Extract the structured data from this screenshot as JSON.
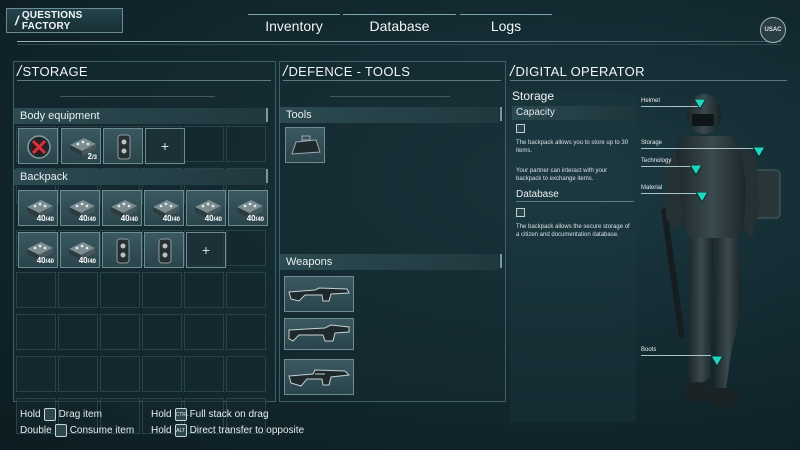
{
  "topbar": {
    "factory_label": "QUESTIONS FACTORY",
    "tabs": [
      "Inventory",
      "Database",
      "Logs"
    ],
    "logo_text": "USAC"
  },
  "storage": {
    "title": "STORAGE",
    "body_equipment_label": "Body equipment",
    "backpack_label": "Backpack",
    "body_items": [
      {
        "icon": "medkit-icon",
        "qty": ""
      },
      {
        "icon": "ammo-box-icon",
        "qty": "2",
        "max": "3"
      },
      {
        "icon": "device-icon",
        "qty": ""
      }
    ],
    "backpack_items": [
      {
        "icon": "ammo-box-icon",
        "qty": "40",
        "max": "40"
      },
      {
        "icon": "ammo-box-icon",
        "qty": "40",
        "max": "40"
      },
      {
        "icon": "ammo-box-icon",
        "qty": "40",
        "max": "40"
      },
      {
        "icon": "ammo-box-icon",
        "qty": "40",
        "max": "40"
      },
      {
        "icon": "ammo-box-icon",
        "qty": "40",
        "max": "40"
      },
      {
        "icon": "ammo-box-icon",
        "qty": "40",
        "max": "40"
      },
      {
        "icon": "ammo-box-icon",
        "qty": "40",
        "max": "40"
      },
      {
        "icon": "ammo-box-icon",
        "qty": "40",
        "max": "40"
      },
      {
        "icon": "device-icon",
        "qty": ""
      },
      {
        "icon": "device-icon",
        "qty": ""
      }
    ],
    "add_symbol": "+"
  },
  "defence": {
    "title": "DEFENCE - TOOLS",
    "tools_label": "Tools",
    "weapons_label": "Weapons",
    "tools": [
      "toolcase-icon"
    ],
    "weapons": [
      "rifle-icon",
      "shotgun-icon",
      "assault-rifle-icon"
    ]
  },
  "operator": {
    "title": "DIGITAL OPERATOR",
    "heading": "Storage",
    "capacity_label": "Capacity",
    "capacity_text_1": "The backpack allows you to store up to 30 items.",
    "capacity_text_2": "Your partner can interact with your backpack to exchange items.",
    "database_label": "Database",
    "database_text": "The backpack allows the secure storage of a citizen and documentation database.",
    "callouts": [
      "Helmet",
      "Storage",
      "Technology",
      "Material",
      "Boots"
    ]
  },
  "hints": [
    {
      "action": "Hold",
      "key": "mouse-left-icon",
      "text": "Drag item"
    },
    {
      "action": "Double",
      "key": "mouse-left-icon",
      "text": "Consume item"
    },
    {
      "action": "Hold",
      "key": "CTRL",
      "text": "Full stack on drag"
    },
    {
      "action": "Hold",
      "key": "ALT",
      "text": "Direct transfer to opposite"
    }
  ],
  "colors": {
    "accent": "#1fd6c0",
    "panel_border": "#3f5f66",
    "background": "#132a31"
  }
}
